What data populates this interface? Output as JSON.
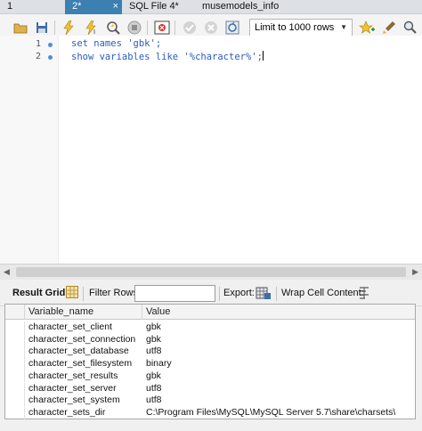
{
  "tabs": [
    {
      "label": "1",
      "active": false
    },
    {
      "label": "2*",
      "active": true,
      "close": "×"
    },
    {
      "label": "SQL File 4*",
      "active": false
    },
    {
      "label": "musemodels_info",
      "active": false
    }
  ],
  "toolbar": {
    "icons": [
      "open-folder-icon",
      "save-icon",
      "execute-icon",
      "execute-current-icon",
      "explain-icon",
      "stop-icon",
      "toggle-error-icon",
      "commit-icon",
      "rollback-icon",
      "autocommit-icon",
      "favorite-icon",
      "beautify-icon",
      "find-icon",
      "invisible-chars-icon"
    ],
    "limit_value": "Limit to 1000 rows"
  },
  "editor": {
    "lines": [
      {
        "number": "1",
        "code": "set names 'gbk';"
      },
      {
        "number": "2",
        "code": "show variables like '%character%';"
      }
    ]
  },
  "result_toolbar": {
    "result_grid_label": "Result Grid",
    "filter_rows_label": "Filter Rows:",
    "filter_rows_value": "",
    "export_label": "Export:",
    "wrap_label": "Wrap Cell Content:"
  },
  "grid": {
    "columns": [
      "Variable_name",
      "Value"
    ],
    "rows": [
      [
        "character_set_client",
        "gbk"
      ],
      [
        "character_set_connection",
        "gbk"
      ],
      [
        "character_set_database",
        "utf8"
      ],
      [
        "character_set_filesystem",
        "binary"
      ],
      [
        "character_set_results",
        "gbk"
      ],
      [
        "character_set_server",
        "utf8"
      ],
      [
        "character_set_system",
        "utf8"
      ],
      [
        "character_sets_dir",
        "C:\\Program Files\\MySQL\\MySQL Server 5.7\\share\\charsets\\"
      ]
    ]
  },
  "colors": {
    "active_tab": "#3c7fb1",
    "code_text": "#2a5bbf",
    "line_dot": "#4a90d9"
  }
}
